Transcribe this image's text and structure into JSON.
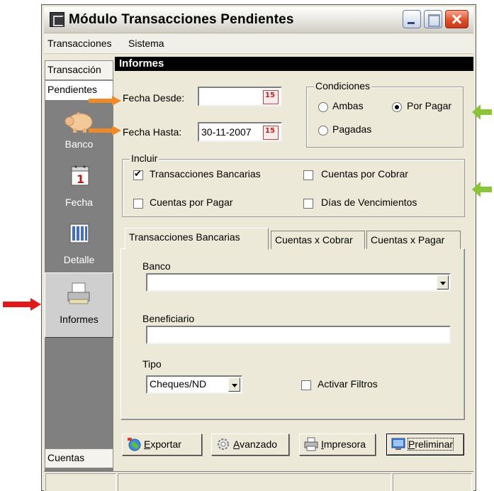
{
  "window": {
    "title": "Módulo Transacciones Pendientes"
  },
  "menu": {
    "items": [
      "Transacciones",
      "Sistema"
    ]
  },
  "sidebar": {
    "tab_top": "Transacción",
    "tab_second": "Pendientes",
    "items": [
      {
        "label": "Banco",
        "icon": "pig-icon"
      },
      {
        "label": "Fecha",
        "icon": "calendar-icon"
      },
      {
        "label": "Detalle",
        "icon": "detail-icon"
      },
      {
        "label": "Informes",
        "icon": "printer-report-icon",
        "selected": true
      }
    ],
    "tab_bottom": "Cuentas"
  },
  "header": {
    "title": "Informes"
  },
  "filters": {
    "fecha_desde_label": "Fecha Desde:",
    "fecha_desde_value": "",
    "fecha_hasta_label": "Fecha Hasta:",
    "fecha_hasta_value": "30-11-2007"
  },
  "condiciones": {
    "title": "Condiciones",
    "options": [
      {
        "label": "Ambas",
        "selected": false
      },
      {
        "label": "Por Pagar",
        "selected": true
      },
      {
        "label": "Pagadas",
        "selected": false
      }
    ]
  },
  "incluir": {
    "title": "Incluir",
    "options": [
      {
        "label": "Transacciones Bancarias",
        "checked": true
      },
      {
        "label": "Cuentas por Cobrar",
        "checked": false
      },
      {
        "label": "Cuentas por Pagar",
        "checked": false
      },
      {
        "label": "Días de Vencimientos",
        "checked": false
      }
    ]
  },
  "tabs": [
    {
      "label": "Transacciones Bancarias",
      "active": true
    },
    {
      "label": "Cuentas x Cobrar",
      "active": false
    },
    {
      "label": "Cuentas x Pagar",
      "active": false
    }
  ],
  "form": {
    "banco_label": "Banco",
    "banco_value": "",
    "beneficiario_label": "Beneficiario",
    "beneficiario_value": "",
    "tipo_label": "Tipo",
    "tipo_value": "Cheques/ND",
    "activar_filtros_label": "Activar Filtros",
    "activar_filtros_checked": false
  },
  "buttons": {
    "exportar_first": "E",
    "exportar_rest": "xportar",
    "avanzado_first": "A",
    "avanzado_rest": "vanzado",
    "impresora_first": "I",
    "impresora_rest": "mpresora",
    "preliminar_first": "P",
    "preliminar_rest": "reliminar"
  },
  "colors": {
    "arrow_orange": "#ef8a2a",
    "arrow_green": "#8bc33a",
    "arrow_red": "#e0191b",
    "header_band": "#000000",
    "sidebar": "#808080"
  }
}
